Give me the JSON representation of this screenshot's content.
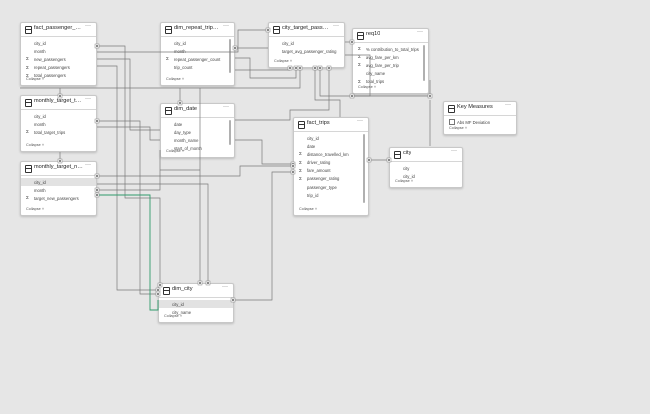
{
  "collapse_label": "Collapse ˄",
  "more_label": "···",
  "tables": [
    {
      "id": "fact_passenger_summary",
      "title": "fact_passenger_summary",
      "fields": [
        {
          "name": "city_id",
          "agg": false
        },
        {
          "name": "month",
          "agg": false
        },
        {
          "name": "new_passengers",
          "agg": true
        },
        {
          "name": "repeat_passengers",
          "agg": true
        },
        {
          "name": "total_passengers",
          "agg": true
        }
      ]
    },
    {
      "id": "dim_repeat_trip_distribution",
      "title": "dim_repeat_trip_distrib...",
      "fields": [
        {
          "name": "city_id",
          "agg": false
        },
        {
          "name": "month",
          "agg": false
        },
        {
          "name": "repeat_passenger_count",
          "agg": true
        },
        {
          "name": "trip_count",
          "agg": false
        }
      ]
    },
    {
      "id": "city_target_passenger_rating",
      "title": "city_target_passenger_r...",
      "fields": [
        {
          "name": "city_id",
          "agg": false
        },
        {
          "name": "target_avg_passenger_rating",
          "agg": false
        }
      ]
    },
    {
      "id": "req10",
      "title": "req10",
      "fields": [
        {
          "name": "% contribution_to_total_trips",
          "agg": true
        },
        {
          "name": "avg_fare_per_km",
          "agg": true
        },
        {
          "name": "avg_fare_per_trip",
          "agg": true
        },
        {
          "name": "city_name",
          "agg": false
        },
        {
          "name": "total_trips",
          "agg": true
        }
      ]
    },
    {
      "id": "key_measures",
      "title": "Key Measures",
      "fields": [
        {
          "name": "Abs MF Deviation",
          "agg": false,
          "measure": true
        }
      ]
    },
    {
      "id": "monthly_target_trips",
      "title": "monthly_target_trips",
      "fields": [
        {
          "name": "city_id",
          "agg": false
        },
        {
          "name": "month",
          "agg": false
        },
        {
          "name": "total_target_trips",
          "agg": true
        }
      ]
    },
    {
      "id": "dim_date",
      "title": "dim_date",
      "fields": [
        {
          "name": "date",
          "agg": false
        },
        {
          "name": "day_type",
          "agg": false
        },
        {
          "name": "month_name",
          "agg": false
        },
        {
          "name": "start_of_month",
          "agg": false
        }
      ]
    },
    {
      "id": "fact_trips",
      "title": "fact_trips",
      "fields": [
        {
          "name": "city_id",
          "agg": false
        },
        {
          "name": "date",
          "agg": false
        },
        {
          "name": "distance_travelled_km",
          "agg": true
        },
        {
          "name": "driver_rating",
          "agg": true
        },
        {
          "name": "fare_amount",
          "agg": true
        },
        {
          "name": "passenger_rating",
          "agg": true
        },
        {
          "name": "passenger_type",
          "agg": false
        },
        {
          "name": "trip_id",
          "agg": false
        }
      ]
    },
    {
      "id": "city",
      "title": "city",
      "fields": [
        {
          "name": "city",
          "agg": false
        },
        {
          "name": "city_id",
          "agg": false
        }
      ]
    },
    {
      "id": "monthly_target_new_passengers",
      "title": "monthly_target_new_pa...",
      "fields": [
        {
          "name": "city_id",
          "agg": false,
          "selected": true
        },
        {
          "name": "month",
          "agg": false
        },
        {
          "name": "target_new_passengers",
          "agg": true
        }
      ]
    },
    {
      "id": "dim_city",
      "title": "dim_city",
      "fields": [
        {
          "name": "city_id",
          "agg": false,
          "selected": true
        },
        {
          "name": "city_name",
          "agg": false
        }
      ]
    }
  ]
}
